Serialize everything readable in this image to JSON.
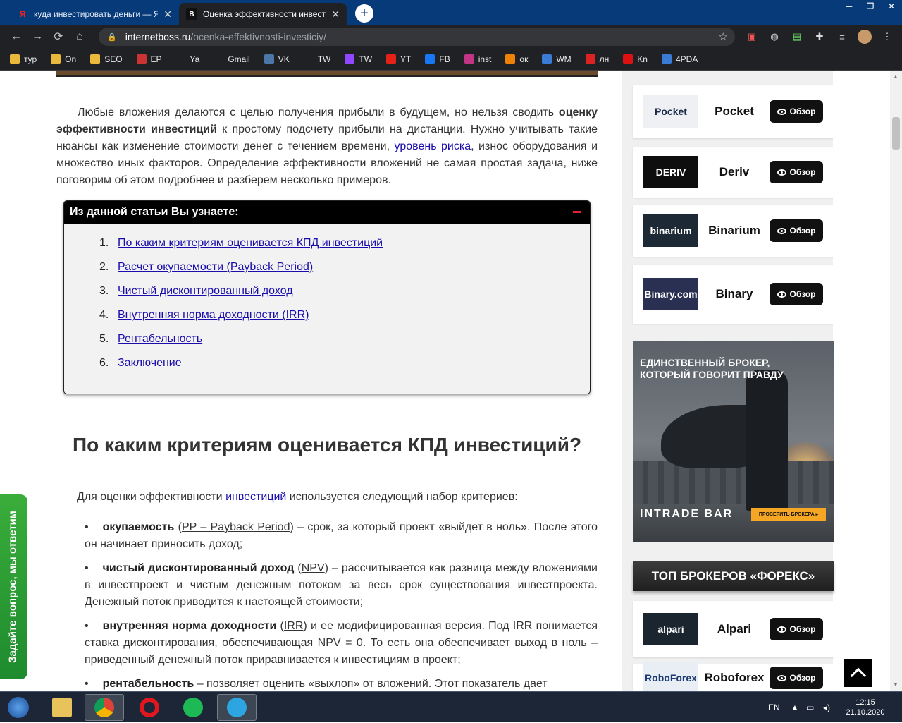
{
  "browser": {
    "tabs": [
      {
        "title": "куда инвестировать деньги — Я",
        "icon": "yandex-icon",
        "active": false
      },
      {
        "title": "Оценка эффективности инвести",
        "icon": "site-favicon",
        "active": true
      }
    ],
    "url_host": "internetboss.ru",
    "url_path": "/ocenka-effektivnosti-investiciy/",
    "bookmarks": [
      {
        "label": "тур",
        "icon": "folder-icon",
        "color": "#e8b93a"
      },
      {
        "label": "On",
        "icon": "folder-icon",
        "color": "#e8b93a"
      },
      {
        "label": "SEO",
        "icon": "folder-icon",
        "color": "#e8b93a"
      },
      {
        "label": "EP",
        "icon": "ep-icon",
        "color": "#c33"
      },
      {
        "label": "Ya",
        "icon": "yandex-icon",
        "color": "#202124"
      },
      {
        "label": "Gmail",
        "icon": "gmail-icon",
        "color": "#202124"
      },
      {
        "label": "VK",
        "icon": "vk-icon",
        "color": "#4a76a8"
      },
      {
        "label": "TW",
        "icon": "twitter-icon",
        "color": "#202124"
      },
      {
        "label": "TW",
        "icon": "twitch-icon",
        "color": "#9146ff"
      },
      {
        "label": "YT",
        "icon": "youtube-icon",
        "color": "#e62117"
      },
      {
        "label": "FB",
        "icon": "facebook-icon",
        "color": "#1877f2"
      },
      {
        "label": "inst",
        "icon": "instagram-icon",
        "color": "#c13584"
      },
      {
        "label": "ок",
        "icon": "ok-icon",
        "color": "#ee8208"
      },
      {
        "label": "WM",
        "icon": "webmoney-icon",
        "color": "#3a7bd5"
      },
      {
        "label": "лн",
        "icon": "ln-icon",
        "color": "#d22"
      },
      {
        "label": "Kn",
        "icon": "kn-icon",
        "color": "#d11"
      },
      {
        "label": "4PDA",
        "icon": "4pda-icon",
        "color": "#3a7bd5"
      }
    ]
  },
  "article": {
    "intro_pre": "Любые вложения делаются с целью получения прибыли в будущем, но нельзя сводить ",
    "intro_bold": "оценку эффективности инвестиций",
    "intro_mid": " к простому подсчету прибыли на дистанции. Нужно учитывать такие нюансы как изменение стоимости денег с течением времени, ",
    "intro_link": "уровень риска",
    "intro_post": ", износ оборудования и множество иных факторов. Определение эффективности вложений не самая простая задача, ниже поговорим об этом подробнее и разберем несколько примеров.",
    "toc_title": "Из данной статьи Вы узнаете:",
    "toc_items": [
      {
        "n": "1.",
        "label": "По каким критериям оценивается КПД инвестиций"
      },
      {
        "n": "2.",
        "label": "Расчет окупаемости (Payback Period)"
      },
      {
        "n": "3.",
        "label": "Чистый дисконтированный доход"
      },
      {
        "n": "4.",
        "label": "Внутренняя норма доходности (IRR)"
      },
      {
        "n": "5.",
        "label": "Рентабельность"
      },
      {
        "n": "6.",
        "label": "Заключение"
      }
    ],
    "h2": "По каким критериям оценивается КПД инвестиций?",
    "lead_pre": "Для оценки эффективности ",
    "lead_link": "инвестиций",
    "lead_post": " используется следующий набор критериев:",
    "criteria": [
      {
        "bold": "окупаемость",
        "open": " (",
        "abbr": "PP – Payback Period",
        "rest": ") – срок, за который проект «выйдет в ноль». После этого он начинает приносить доход;"
      },
      {
        "bold": "чистый дисконтированный доход",
        "open": " (",
        "abbr": "NPV",
        "rest": ") – рассчитывается как разница между вложениями в инвестпроект и чистым денежным потоком за весь срок существования инвестпроекта. Денежный поток приводится к настоящей стоимости;"
      },
      {
        "bold": "внутренняя норма доходности",
        "open": " (",
        "abbr": "IRR",
        "rest": ") и ее модифицированная версия. Под IRR понимается ставка дисконтирования, обеспечивающая NPV = 0. То есть она обеспечивает выход в ноль – приведенный денежный поток приравнивается к инвестициям в проект;"
      },
      {
        "bold": "рентабельность",
        "open": "",
        "abbr": "",
        "rest": " – позволяет оценить «выхлоп» от вложений. Этот показатель дает"
      }
    ]
  },
  "sidebar": {
    "review_label": "Обзор",
    "brokers": [
      {
        "name": "Pocket",
        "logo_text": "Pocket",
        "logo_bg": "#eef0f4",
        "logo_fg": "#1b2a48"
      },
      {
        "name": "Deriv",
        "logo_text": "DERIV",
        "logo_bg": "#0e0e0e",
        "logo_fg": "#ffffff"
      },
      {
        "name": "Binarium",
        "logo_text": "binarium",
        "logo_bg": "#1d2a35",
        "logo_fg": "#ffffff"
      },
      {
        "name": "Binary",
        "logo_text": "Binary.com",
        "logo_bg": "#2a3052",
        "logo_fg": "#ffffff"
      }
    ],
    "ad": {
      "title": "ЕДИНСТВЕННЫЙ БРОКЕР, КОТОРЫЙ ГОВОРИТ ПРАВДУ",
      "brand": "INTRADE BAR",
      "cta": "ПРОВЕРИТЬ БРОКЕРА ▸"
    },
    "forex_title": "ТОП БРОКЕРОВ «ФОРЕКС»",
    "forex_brokers": [
      {
        "name": "Alpari",
        "logo_text": "alpari",
        "logo_bg": "#1a2530",
        "logo_fg": "#ffffff"
      },
      {
        "name": "Roboforex",
        "logo_text": "RoboForex",
        "logo_bg": "#e9eef5",
        "logo_fg": "#1b3a70"
      }
    ]
  },
  "feedback_label": "Задайте вопрос, мы ответим",
  "taskbar": {
    "lang": "EN",
    "time": "12:15",
    "date": "21.10.2020",
    "apps": [
      "explorer-icon",
      "chrome-icon",
      "opera-icon",
      "spotify-icon",
      "telegram-icon"
    ]
  }
}
